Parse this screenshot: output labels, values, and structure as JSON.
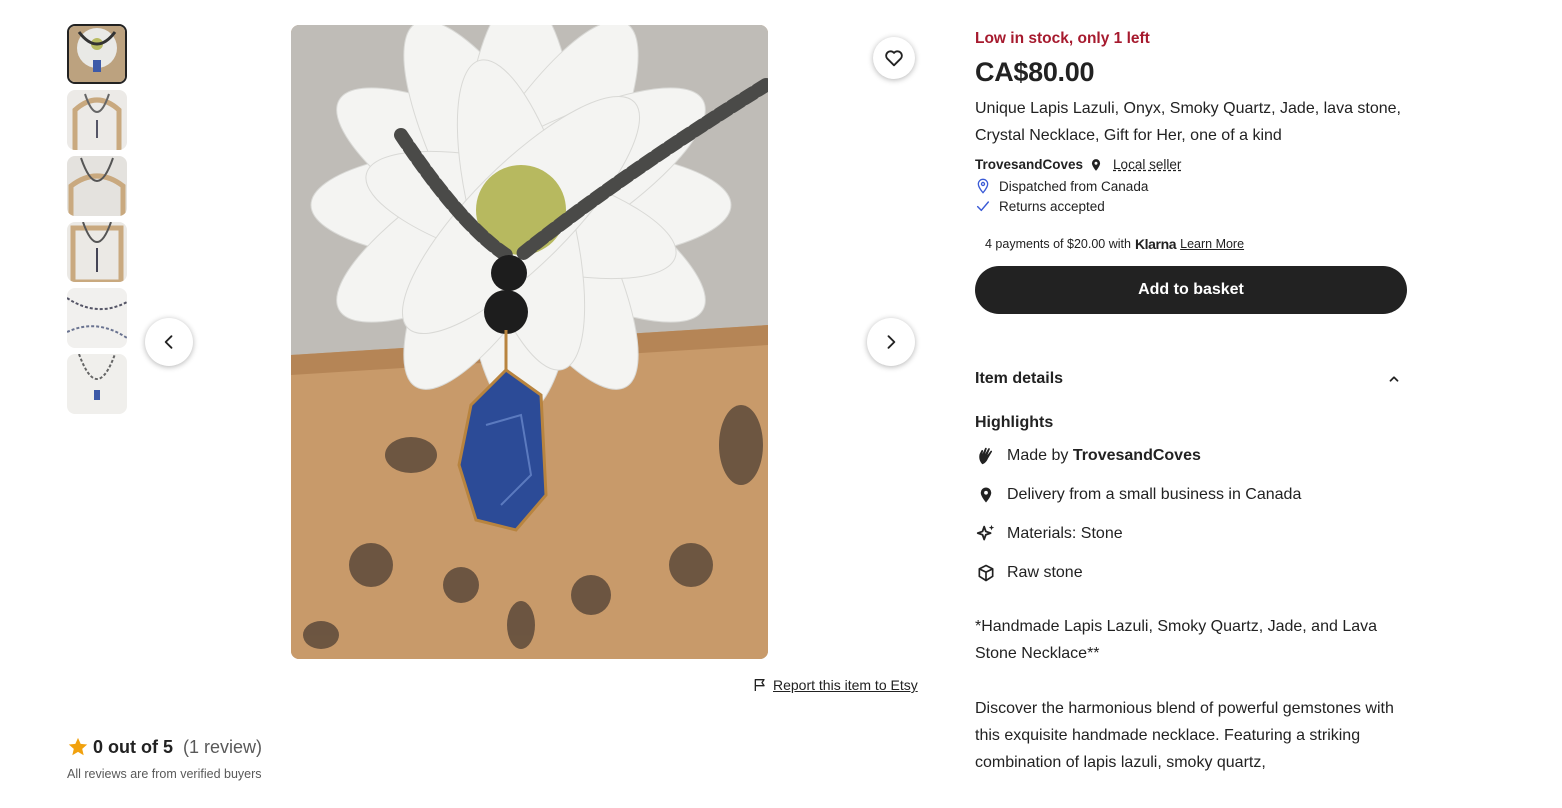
{
  "gallery": {
    "thumbnail_count": 6,
    "active_index": 0
  },
  "report_link": "Report this item to Etsy",
  "reviews": {
    "score": "0 out of 5",
    "count": "(1 review)",
    "verified_note": "All reviews are from verified buyers"
  },
  "product": {
    "stock": "Low in stock, only 1 left",
    "price": "CA$80.00",
    "title": "Unique Lapis Lazuli, Onyx, Smoky Quartz, Jade, lava stone, Crystal Necklace, Gift for Her, one of a kind",
    "seller": "TrovesandCoves",
    "local_seller": "Local seller",
    "dispatched": "Dispatched from Canada",
    "returns": "Returns accepted",
    "klarna_text": "4 payments of $20.00 with",
    "klarna_brand": "Klarna",
    "klarna_learn": "Learn More",
    "add_to_basket": "Add to basket"
  },
  "details": {
    "heading": "Item details",
    "highlights_heading": "Highlights",
    "made_by_prefix": "Made by ",
    "made_by_name": "TrovesandCoves",
    "delivery": "Delivery from a small business in Canada",
    "materials": "Materials: Stone",
    "raw": "Raw stone",
    "desc1": "*Handmade Lapis Lazuli, Smoky Quartz, Jade, and Lava Stone Necklace**",
    "desc2": "Discover the harmonious blend of powerful gemstones with this exquisite handmade necklace. Featuring a striking combination of lapis lazuli, smoky quartz,"
  },
  "colors": {
    "stock_red": "#a61a2e",
    "button_dark": "#222222",
    "star": "#f1a10d"
  }
}
